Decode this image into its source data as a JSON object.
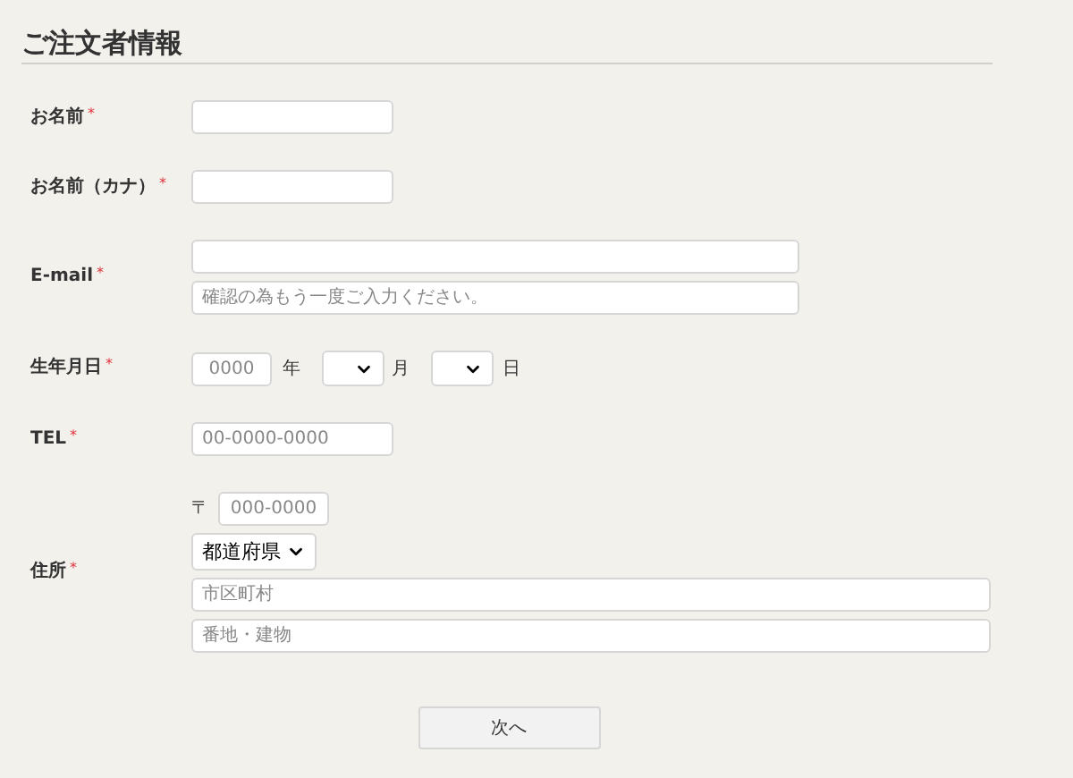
{
  "title": "ご注文者情報",
  "rows": [
    {
      "kind": "text",
      "label": "お名前",
      "mark": "*"
    },
    {
      "kind": "text",
      "label": "お名前（カナ）",
      "mark": "*"
    },
    {
      "kind": "email",
      "label": "E-mail",
      "mark": "*",
      "confirm_placeholder": "確認の為もう一度ご入力ください。"
    },
    {
      "kind": "date",
      "label": "生年月日",
      "mark": "*",
      "year": {
        "placeholder": "0000",
        "unit": "年"
      },
      "month": {
        "unit": "月"
      },
      "day": {
        "unit": "日"
      }
    },
    {
      "kind": "text",
      "label": "TEL",
      "mark": "*",
      "placeholder": "00-0000-0000"
    },
    {
      "kind": "address",
      "label": "住所",
      "mark": "*",
      "postal": {
        "symbol": "〒",
        "placeholder": "000-0000"
      },
      "prefecture": {
        "value": "都道府県"
      },
      "fields": [
        {
          "placeholder": "市区町村"
        },
        {
          "placeholder": "番地・建物"
        }
      ]
    }
  ],
  "next_button": "次へ"
}
